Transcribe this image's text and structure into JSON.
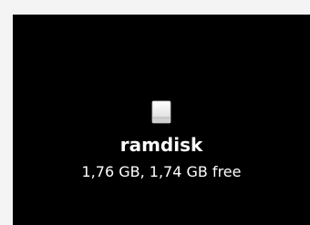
{
  "desktop": {
    "background_color": "#000000",
    "volume": {
      "icon": "external-disk-icon",
      "name": "ramdisk",
      "info": "1,76 GB, 1,74 GB free"
    }
  }
}
